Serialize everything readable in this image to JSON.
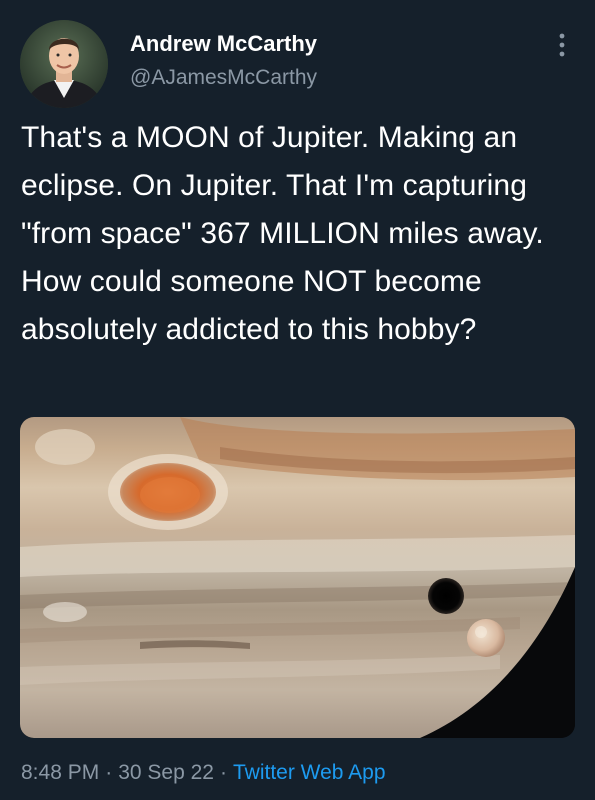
{
  "author": {
    "display_name": "Andrew McCarthy",
    "handle": "@AJamesMcCarthy"
  },
  "icons": {
    "more": "more-vertical-icon",
    "avatar": "profile-photo"
  },
  "tweet": {
    "text": "That's a MOON of Jupiter. Making an eclipse. On Jupiter. That I'm capturing \"from space\" 367 MILLION miles away. How could someone NOT become absolutely addicted to this hobby?"
  },
  "meta": {
    "time": "8:48 PM",
    "separator": "·",
    "date": "30 Sep 22",
    "source": "Twitter Web App"
  },
  "colors": {
    "background": "#15202b",
    "text": "#ffffff",
    "secondary_text": "#8b98a5",
    "link": "#1d9bf0"
  }
}
